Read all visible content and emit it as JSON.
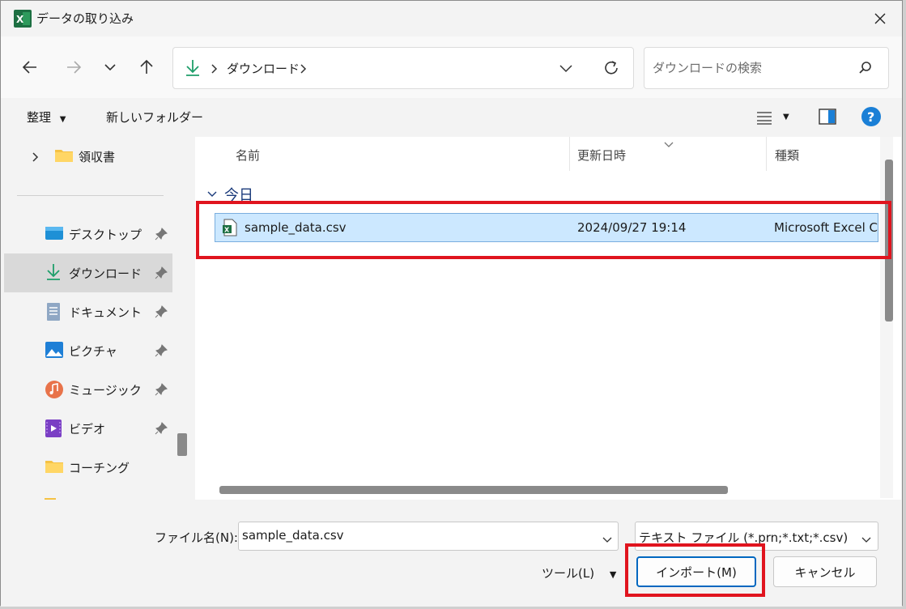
{
  "window": {
    "title": "データの取り込み",
    "app_icon": "excel-icon"
  },
  "nav": {
    "address_folder": "ダウンロード",
    "search_placeholder": "ダウンロードの検索"
  },
  "commands": {
    "organize": "整理",
    "new_folder": "新しいフォルダー"
  },
  "sidebar": {
    "items": [
      {
        "label": "領収書",
        "icon": "folder-icon"
      },
      {
        "label": "デスクトップ",
        "icon": "desktop-icon"
      },
      {
        "label": "ダウンロード",
        "icon": "download-icon"
      },
      {
        "label": "ドキュメント",
        "icon": "document-icon"
      },
      {
        "label": "ピクチャ",
        "icon": "pictures-icon"
      },
      {
        "label": "ミュージック",
        "icon": "music-icon"
      },
      {
        "label": "ビデオ",
        "icon": "video-icon"
      },
      {
        "label": "コーチング",
        "icon": "folder-icon"
      }
    ]
  },
  "columns": {
    "name": "名前",
    "modified": "更新日時",
    "type": "種類"
  },
  "group": {
    "label": "今日"
  },
  "files": [
    {
      "name": "sample_data.csv",
      "modified": "2024/09/27 19:14",
      "type": "Microsoft Excel CSV"
    }
  ],
  "footer": {
    "filename_label": "ファイル名(N):",
    "filename_value": "sample_data.csv",
    "filetype_value": "テキスト ファイル (*.prn;*.txt;*.csv)",
    "tools_label": "ツール(L)",
    "import_label": "インポート(M)",
    "cancel_label": "キャンセル"
  },
  "colors": {
    "highlight": "#e0141e",
    "selection": "#cce8ff",
    "accent": "#0067c0"
  }
}
